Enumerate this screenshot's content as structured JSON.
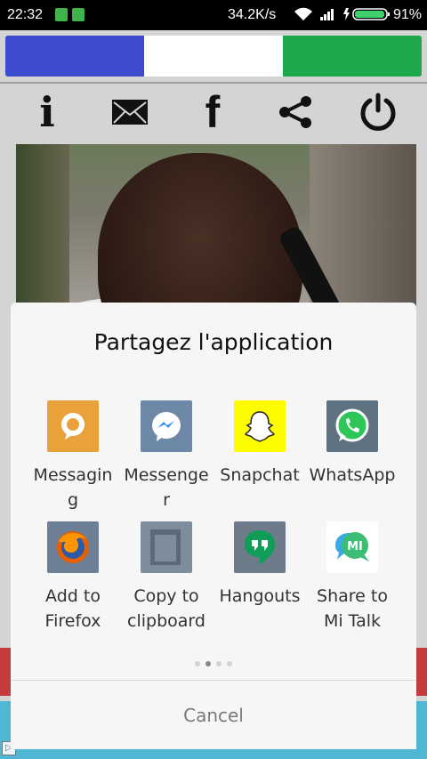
{
  "status_bar": {
    "time": "22:32",
    "speed": "34.2K/s",
    "battery_pct": "91%"
  },
  "flag_colors": [
    "#3d4bd0",
    "#ffffff",
    "#1fa84a"
  ],
  "toolbar": {
    "items": [
      {
        "name": "info-icon",
        "glyph": "i"
      },
      {
        "name": "mail-icon"
      },
      {
        "name": "facebook-icon",
        "glyph": "f"
      },
      {
        "name": "share-icon"
      },
      {
        "name": "power-icon"
      }
    ]
  },
  "share_sheet": {
    "title": "Partagez l'application",
    "apps": [
      {
        "label": "Messagin\ng",
        "icon": "messaging-icon",
        "color": "#e9a23b"
      },
      {
        "label": "Messenge\nr",
        "icon": "messenger-icon",
        "color": "#6d87a6"
      },
      {
        "label": "Snapchat",
        "icon": "snapchat-icon",
        "color": "#fffc00"
      },
      {
        "label": "WhatsApp",
        "icon": "whatsapp-icon",
        "color": "#5f7282"
      },
      {
        "label": "Add to\nFirefox",
        "icon": "firefox-icon",
        "color": "#6d7f95"
      },
      {
        "label": "Copy to\nclipboard",
        "icon": "clipboard-icon",
        "color": "#7d8d9c"
      },
      {
        "label": "Hangouts",
        "icon": "hangouts-icon",
        "color": "#6d7b8a"
      },
      {
        "label": "Share to\nMi Talk",
        "icon": "mitalk-icon",
        "color": "#ffffff"
      }
    ],
    "pager": {
      "pages": 4,
      "active": 1
    },
    "cancel": "Cancel"
  }
}
